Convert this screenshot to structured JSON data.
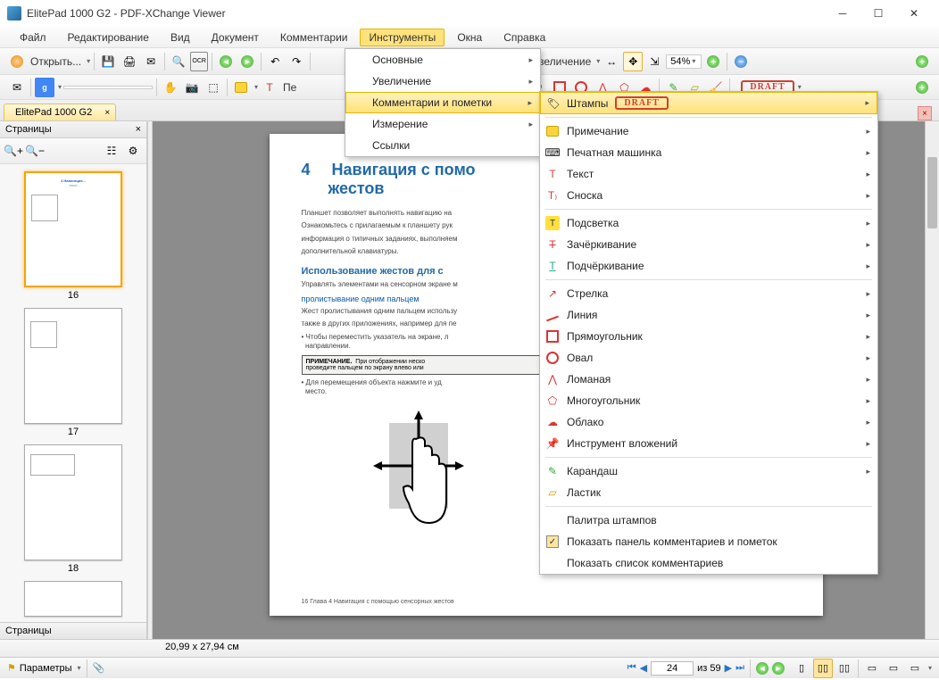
{
  "title": "ElitePad 1000 G2 - PDF-XChange Viewer",
  "menu": {
    "file": "Файл",
    "edit": "Редактирование",
    "view": "Вид",
    "document": "Документ",
    "comments": "Комментарии",
    "tools": "Инструменты",
    "windows": "Окна",
    "help": "Справка"
  },
  "toolbar": {
    "open": "Открыть...",
    "zoomlabel": "Увеличение",
    "zoom_value": "54%",
    "pe": "Пе"
  },
  "tab_name": "ElitePad 1000 G2",
  "sidebar": {
    "title": "Страницы",
    "footer": "Страницы",
    "thumbs": [
      {
        "num": "16"
      },
      {
        "num": "17"
      },
      {
        "num": "18"
      }
    ]
  },
  "page": {
    "chapter_num": "4",
    "chapter_title": "Навигация с помо",
    "chapter_title2": "жестов",
    "intro": "Планшет позволяет выполнять навигацию на",
    "intro2": "Ознакомьтесь с прилагаемым к планшету рук",
    "intro3": "информация о типичных заданиях, выполняем",
    "intro4": "дополнительной клавиатуры.",
    "section1": "Использование жестов для с",
    "section1_text": "Управлять элементами на сенсорном экране м",
    "section2": "пролистывание одним пальцем",
    "section2_text": "Жест пролистывания одним пальцем использу",
    "section2_text2": "также в других приложениях, например для пе",
    "bullet1": "Чтобы переместить указатель на экране, л",
    "bullet1b": "направлении.",
    "note_label": "ПРИМЕЧАНИЕ.",
    "note_text": "При отображении неско",
    "note_text2": "проведите пальцем по экрану влево или",
    "bullet2": "Для перемещения объекта нажмите и уд",
    "bullet2b": "место.",
    "page_footer": "16    Глава 4   Навигация с помощью сенсорных жестов"
  },
  "menu_tools": {
    "basic": "Основные",
    "zoom": "Увеличение",
    "comments": "Комментарии и пометки",
    "measure": "Измерение",
    "links": "Ссылки"
  },
  "menu_comments": {
    "stamps": "Штампы",
    "draft": "DRAFT",
    "note": "Примечание",
    "typewriter": "Печатная машинка",
    "text": "Текст",
    "footnote": "Сноска",
    "highlight": "Подсветка",
    "strikethrough": "Зачёркивание",
    "underline": "Подчёркивание",
    "arrow_tool": "Стрелка",
    "line_tool": "Линия",
    "rect_tool": "Прямоугольник",
    "oval_tool": "Овал",
    "polyline": "Ломаная",
    "polygon": "Многоугольник",
    "cloud": "Облако",
    "attachment": "Инструмент вложений",
    "pencil": "Карандаш",
    "eraser": "Ластик",
    "palette": "Палитра штампов",
    "show_panel": "Показать панель комментариев и пометок",
    "show_list": "Показать список комментариев"
  },
  "status": {
    "options": "Параметры",
    "page_size": "20,99 x 27,94 см",
    "current_page": "24",
    "total_pages": "из 59"
  }
}
